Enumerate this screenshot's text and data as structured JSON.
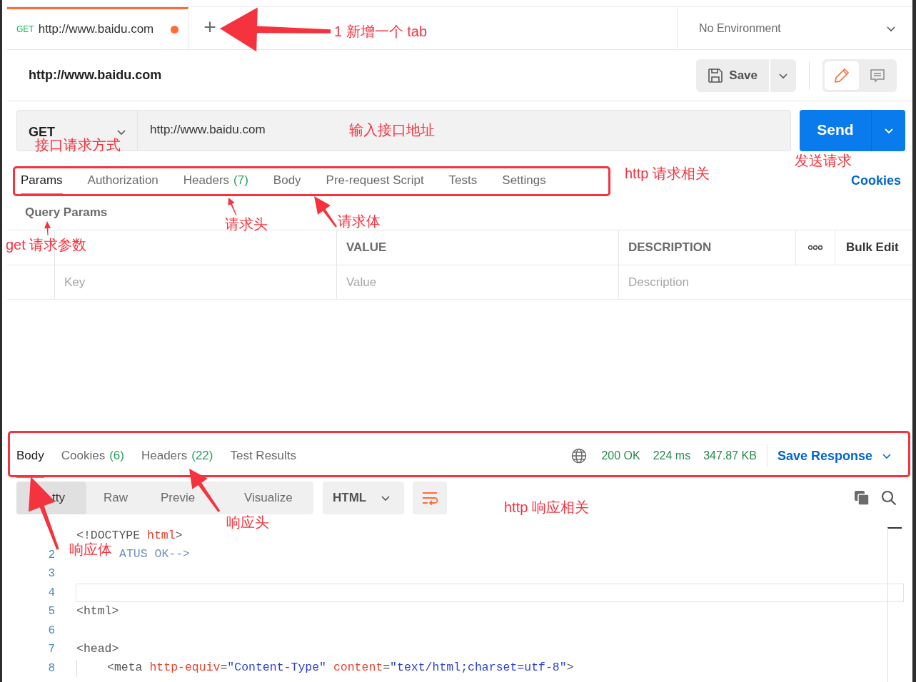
{
  "tabs": [
    {
      "method": "GET",
      "title": "http://www.baidu.com",
      "selected": true,
      "unsaved": true
    }
  ],
  "new_tab_button": "+",
  "environment": "No Environment",
  "request_title": "http://www.baidu.com",
  "save_button": "Save",
  "mode_toggle": [
    {
      "kind": "edit",
      "selected": true
    },
    {
      "kind": "comments",
      "selected": false
    }
  ],
  "request": {
    "method": "GET",
    "url": "http://www.baidu.com",
    "send_button": "Send"
  },
  "request_tabs": [
    {
      "label": "Params",
      "selected": true
    },
    {
      "label": "Authorization",
      "selected": false
    },
    {
      "label": "Headers",
      "count": "(7)",
      "selected": false
    },
    {
      "label": "Body",
      "selected": false
    },
    {
      "label": "Pre-request Script",
      "selected": false
    },
    {
      "label": "Tests",
      "selected": false
    },
    {
      "label": "Settings",
      "selected": false
    }
  ],
  "cookies_link": "Cookies",
  "params": {
    "title": "Query Params",
    "columns": [
      "VALUE",
      "DESCRIPTION"
    ],
    "bulk_edit": "Bulk Edit",
    "placeholders": [
      "Key",
      "Value",
      "Description"
    ]
  },
  "response": {
    "tabs": [
      {
        "label": "Body",
        "selected": true
      },
      {
        "label": "Cookies",
        "count": "(6)",
        "selected": false
      },
      {
        "label": "Headers",
        "count": "(22)",
        "selected": false
      },
      {
        "label": "Test Results",
        "selected": false
      }
    ],
    "status": "200 OK",
    "time": "224 ms",
    "size": "347.87 KB",
    "save_response": "Save Response",
    "views": [
      {
        "label": "tty",
        "selected": true
      },
      {
        "label": "Raw",
        "selected": false
      },
      {
        "label": "Previe",
        "selected": false
      },
      {
        "label": "Visualize",
        "selected": false
      }
    ],
    "language": "HTML",
    "code": [
      {
        "tokens": [
          {
            "kind": "tag",
            "text": "<!DOCTYPE "
          },
          {
            "kind": "attr",
            "text": "html"
          },
          {
            "kind": "tag",
            "text": ">"
          }
        ]
      },
      {
        "number": "2",
        "tokens": [
          {
            "kind": "comment",
            "text": "ATUS OK-->"
          }
        ],
        "covered_start": true
      },
      {
        "number": "3"
      },
      {
        "number": "4",
        "active": true
      },
      {
        "number": "5",
        "tokens": [
          {
            "kind": "tag",
            "text": "<html>"
          }
        ]
      },
      {
        "number": "6"
      },
      {
        "number": "7",
        "tokens": [
          {
            "kind": "tag",
            "text": "<head>"
          }
        ]
      },
      {
        "number": "8",
        "indent": true,
        "tokens": [
          {
            "kind": "tag",
            "text": "<meta "
          },
          {
            "kind": "attr",
            "text": "http-equiv"
          },
          {
            "kind": "tag",
            "text": "="
          },
          {
            "kind": "string",
            "text": "\"Content-Type\" "
          },
          {
            "kind": "attr",
            "text": "content"
          },
          {
            "kind": "tag",
            "text": "="
          },
          {
            "kind": "string",
            "text": "\"text/html;charset=utf-8\""
          },
          {
            "kind": "tag",
            "text": ">"
          }
        ]
      }
    ]
  },
  "annotations": [
    "1 新增一个 tab",
    "输入接口地址",
    "接口请求方式",
    "发送请求",
    "http 请求相关",
    "请求头",
    "请求体",
    "get 请求参数",
    "响应头",
    "响应体",
    "http 响应相关"
  ]
}
